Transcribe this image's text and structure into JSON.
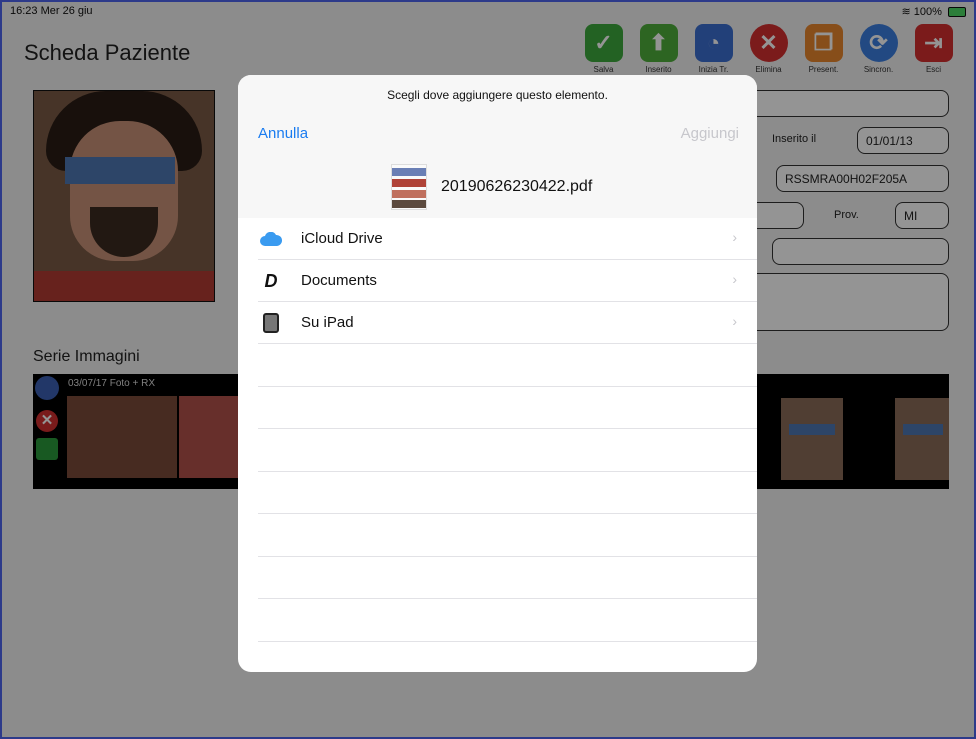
{
  "status_bar": {
    "time_date": "16:23  Mer 26 giu",
    "battery": "100%"
  },
  "app": {
    "title": "Scheda Paziente",
    "toolbar": [
      {
        "label": "Salva",
        "color": "#3daa3d",
        "glyph": "✓"
      },
      {
        "label": "Inserito",
        "color": "#4fae3b",
        "glyph": "⬆"
      },
      {
        "label": "Inizia Tr.",
        "color": "#3b6fd1",
        "glyph": "◔"
      },
      {
        "label": "Elimina",
        "color": "#d43030",
        "glyph": "✕"
      },
      {
        "label": "Present.",
        "color": "#e8872e",
        "glyph": "❐"
      },
      {
        "label": "Sincron.",
        "color": "#3b7fe0",
        "glyph": "⟳"
      },
      {
        "label": "Esci",
        "color": "#d43030",
        "glyph": "⇥"
      }
    ],
    "inserted_label": "Inserito il",
    "inserted_date": "01/01/13",
    "fiscal_code": "RSSMRA00H02F205A",
    "prov_label": "Prov.",
    "prov_value": "MI",
    "series_title": "Serie Immagini",
    "series_date": "03/07/17 Foto + RX"
  },
  "sheet": {
    "prompt": "Scegli dove aggiungere questo elemento.",
    "cancel": "Annulla",
    "add": "Aggiungi",
    "file_name": "20190626230422.pdf",
    "locations": [
      {
        "label": "iCloud Drive",
        "icon": "cloud-icon"
      },
      {
        "label": "Documents",
        "icon": "documents-app-icon"
      },
      {
        "label": "Su iPad",
        "icon": "ipad-icon"
      }
    ]
  }
}
